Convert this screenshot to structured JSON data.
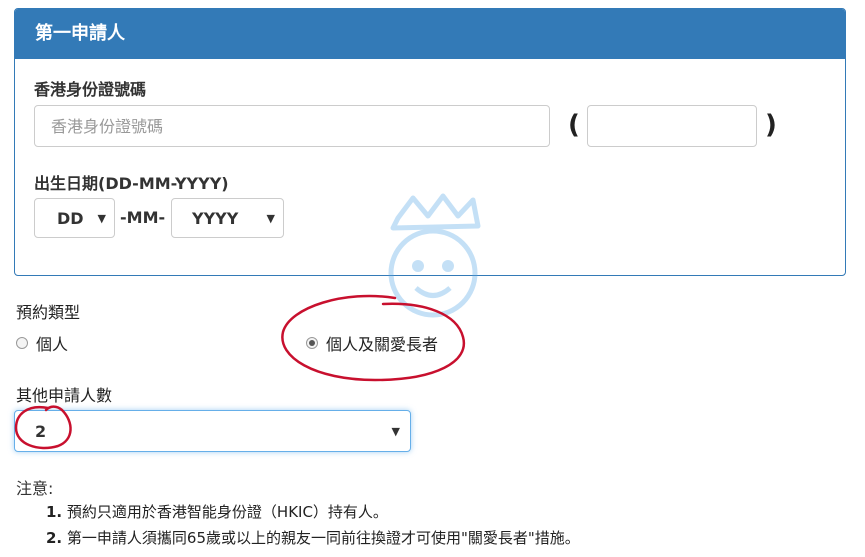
{
  "panel": {
    "title": "第一申請人"
  },
  "hkid": {
    "label": "香港身份證號碼",
    "placeholder": "香港身份證號碼",
    "value": "",
    "check_digit_value": "",
    "open_paren": "(",
    "close_paren": ")"
  },
  "dob": {
    "label": "出生日期(DD-MM-YYYY)",
    "day": "DD",
    "month": "-MM-",
    "year": "YYYY"
  },
  "appointment_type": {
    "label": "預約類型",
    "options": [
      {
        "label": "個人",
        "selected": false
      },
      {
        "label": "個人及關愛長者",
        "selected": true
      }
    ]
  },
  "other_applicants": {
    "label": "其他申請人數",
    "value": "2"
  },
  "notes": {
    "title": "注意:",
    "items": [
      {
        "num": "1.",
        "text": "預約只適用於香港智能身份證（HKIC）持有人。"
      },
      {
        "num": "2.",
        "text": "第一申請人須攜同65歲或以上的親友一同前往換證才可使用\"關愛長者\"措施。"
      }
    ]
  },
  "colors": {
    "primary": "#337ab7",
    "annotation": "#c8102e"
  }
}
